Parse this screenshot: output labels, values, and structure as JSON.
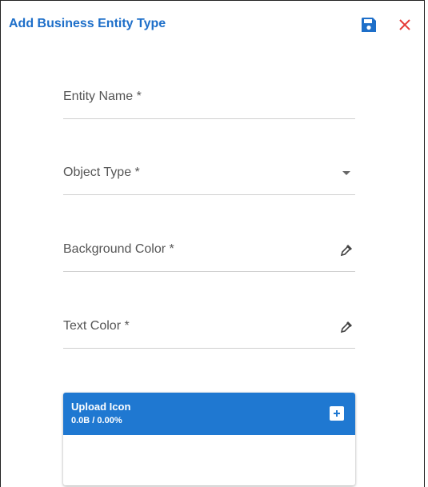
{
  "dialog": {
    "title": "Add Business Entity Type"
  },
  "fields": [
    {
      "label": "Entity Name *",
      "icon": ""
    },
    {
      "label": "Object Type *",
      "icon": "dropdown-arrow-icon"
    },
    {
      "label": "Background Color *",
      "icon": "eyedropper-icon"
    },
    {
      "label": "Text Color *",
      "icon": "eyedropper-icon"
    }
  ],
  "upload": {
    "title": "Upload Icon",
    "size": "0.0B / 0.00%"
  },
  "colors": {
    "accent": "#1e6fc9",
    "upload_header": "#1f78d1",
    "close": "#e53935"
  }
}
